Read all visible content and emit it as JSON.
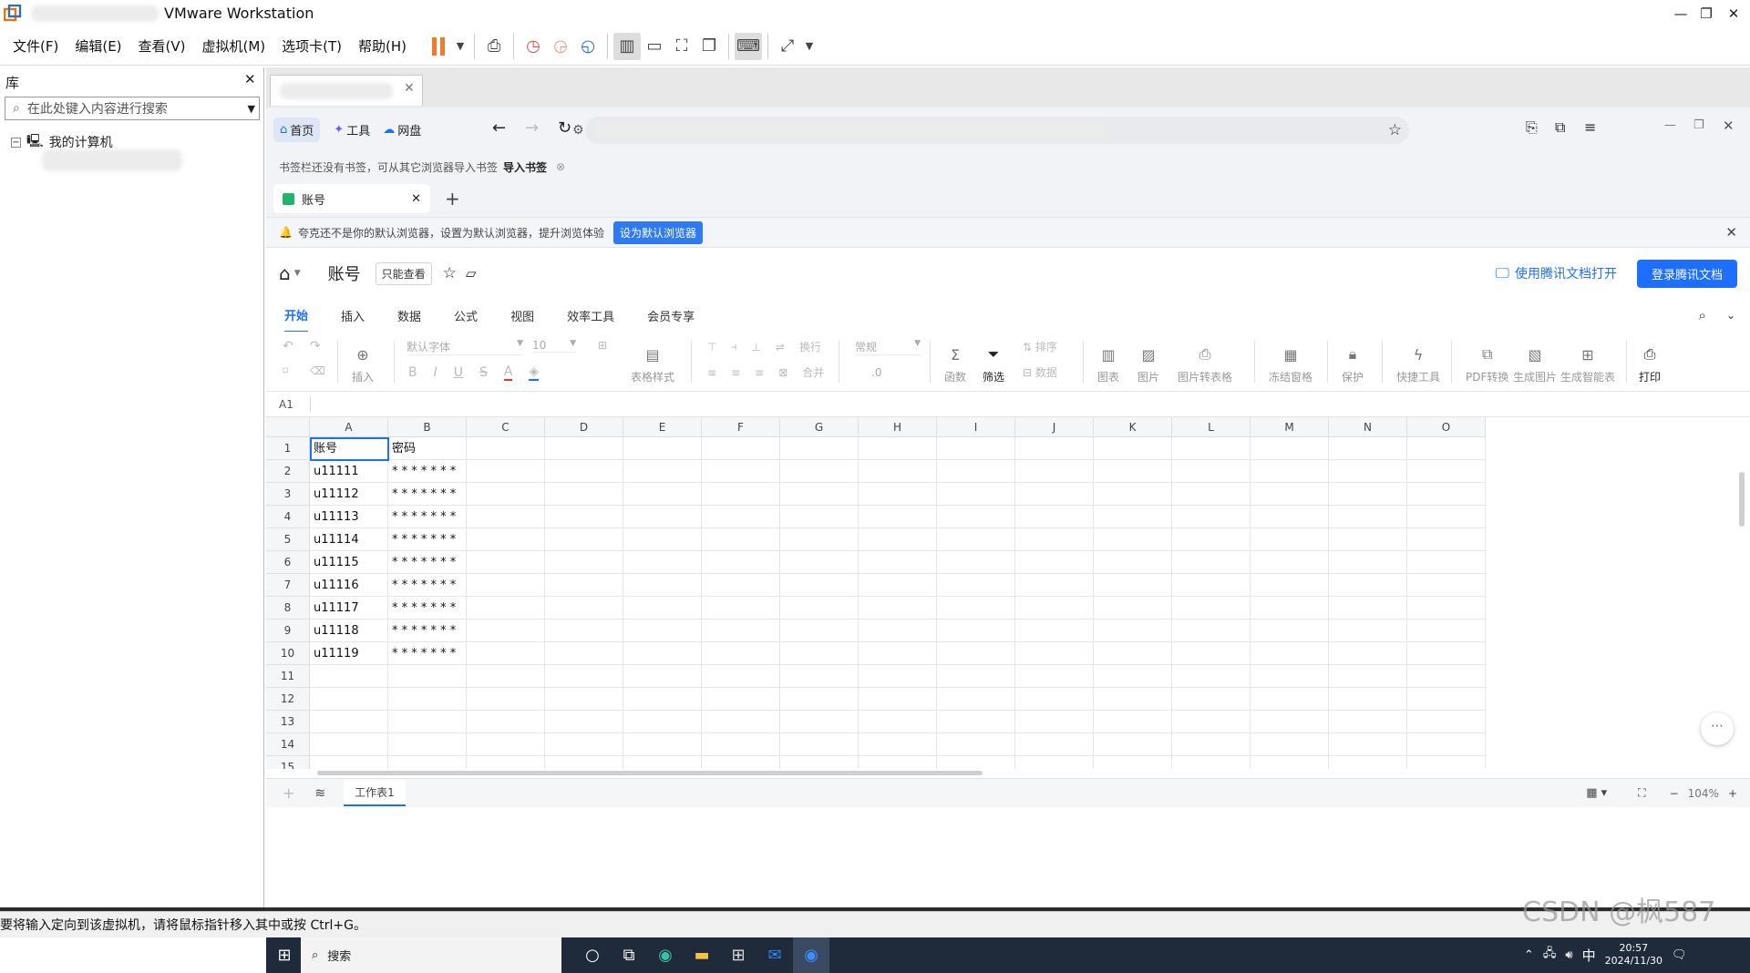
{
  "window": {
    "title": "VMware Workstation"
  },
  "menus": [
    "文件(F)",
    "编辑(E)",
    "查看(V)",
    "虚拟机(M)",
    "选项卡(T)",
    "帮助(H)"
  ],
  "library": {
    "title": "库",
    "search_placeholder": "在此处键入内容进行搜索",
    "tree_root": "我的计算机"
  },
  "browser": {
    "nav": {
      "home": "首页",
      "tools": "工具",
      "cloud": "网盘"
    },
    "bookmarks_bar": {
      "text": "书签栏还没有书签，可从其它浏览器导入书签",
      "import": "导入书签"
    },
    "tab": {
      "title": "账号"
    },
    "notice": {
      "text": "夸克还不是你的默认浏览器，设置为默认浏览器，提升浏览体验",
      "button": "设为默认浏览器"
    }
  },
  "doc": {
    "name": "账号",
    "mode": "只能查看",
    "open_in": "使用腾讯文档打开",
    "login": "登录腾讯文档",
    "ribbon_tabs": [
      "开始",
      "插入",
      "数据",
      "公式",
      "视图",
      "效率工具",
      "会员专享"
    ],
    "ribbon": {
      "insert": "插入",
      "font": "默认字体",
      "size": "10",
      "table_style": "表格样式",
      "wrap": "换行",
      "merge": "合并",
      "format": "常规",
      "decimal": ".0",
      "func": "函数",
      "filter": "筛选",
      "sort": "排序",
      "data": "数据",
      "chart": "图表",
      "image": "图片",
      "img2table": "图片转表格",
      "freeze": "冻结窗格",
      "protect": "保护",
      "quick": "快捷工具",
      "pdf": "PDF转换",
      "gen_img": "生成图片",
      "gen_smart": "生成智能表",
      "print": "打印"
    },
    "cell_ref": "A1",
    "columns": [
      "A",
      "B",
      "C",
      "D",
      "E",
      "F",
      "G",
      "H",
      "I",
      "J",
      "K",
      "L",
      "M",
      "N",
      "O"
    ],
    "rows": [
      [
        "账号",
        "密码"
      ],
      [
        "u11111",
        "* * * * * * *"
      ],
      [
        "u11112",
        "* * * * * * *"
      ],
      [
        "u11113",
        "* * * * * * *"
      ],
      [
        "u11114",
        "* * * * * * *"
      ],
      [
        "u11115",
        "* * * * * * *"
      ],
      [
        "u11116",
        "* * * * * * *"
      ],
      [
        "u11117",
        "* * * * * * *"
      ],
      [
        "u11118",
        "* * * * * * *"
      ],
      [
        "u11119",
        "* * * * * * *"
      ],
      [
        "",
        ""
      ],
      [
        "",
        ""
      ],
      [
        "",
        ""
      ],
      [
        "",
        ""
      ],
      [
        "",
        ""
      ],
      [
        "",
        ""
      ],
      [
        "",
        ""
      ],
      [
        "",
        ""
      ]
    ],
    "sheet": "工作表1",
    "zoom": "104%"
  },
  "taskbar": {
    "search": "搜索",
    "ime": "中",
    "time": "20:57",
    "date": "2024/11/30"
  },
  "statusbar": {
    "text": "要将输入定向到该虚拟机，请将鼠标指针移入其中或按 Ctrl+G。"
  },
  "watermark": "CSDN @枫587"
}
